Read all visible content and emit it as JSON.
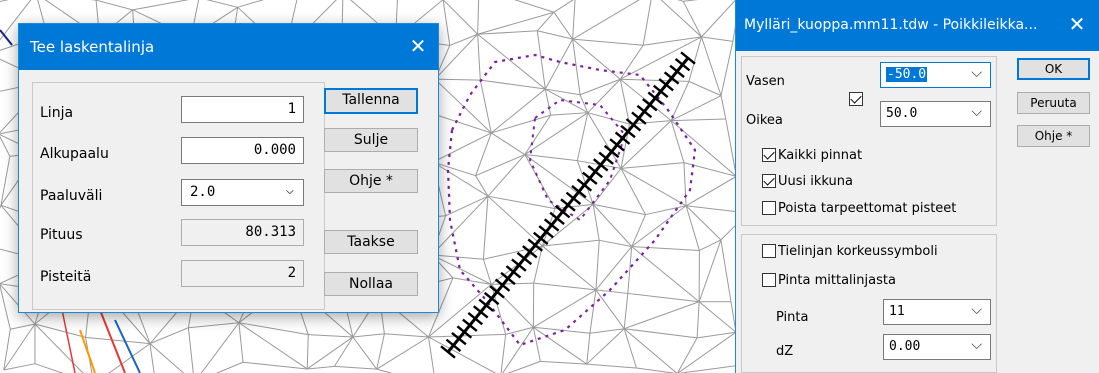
{
  "dialog_laskentalinja": {
    "title": "Tee laskentalinja",
    "close_glyph": "✕",
    "fields": {
      "linja": {
        "label": "Linja",
        "value": "1"
      },
      "alkupaalu": {
        "label": "Alkupaalu",
        "value": "0.000"
      },
      "paaluvali": {
        "label": "Paaluväli",
        "value": "2.0"
      },
      "pituus": {
        "label": "Pituus",
        "value": "80.313"
      },
      "pisteita": {
        "label": "Pisteitä",
        "value": "2"
      }
    },
    "buttons": {
      "tallenna": "Tallenna",
      "sulje": "Sulje",
      "ohje": "Ohje *",
      "taakse": "Taakse",
      "nollaa": "Nollaa"
    }
  },
  "dialog_poikkileikkaus": {
    "title": "Mylläri_kuoppa.mm11.tdw - Poikkileikka...",
    "close_glyph": "✕",
    "vasen": {
      "label": "Vasen",
      "value": "-50.0"
    },
    "oikea": {
      "label": "Oikea",
      "value": "50.0"
    },
    "checkboxes": {
      "kaikki_pinnat": {
        "label": "Kaikki pinnat",
        "checked": true
      },
      "uusi_ikkuna": {
        "label": "Uusi ikkuna",
        "checked": true
      },
      "poista": {
        "label": "Poista tarpeettomat pisteet",
        "checked": false
      },
      "tielinjan": {
        "label": "Tielinjan korkeussymboli",
        "checked": false
      },
      "pinta_mittalinjasta": {
        "label": "Pinta mittalinjasta",
        "checked": false
      }
    },
    "pinta": {
      "label": "Pinta",
      "value": "11"
    },
    "dz": {
      "label": "dZ",
      "value": "0.00"
    },
    "buttons": {
      "ok": "OK",
      "peruuta": "Peruuta",
      "ohje": "Ohje *"
    }
  },
  "icons": {
    "dropdown": "chevron-down-icon",
    "close": "close-icon",
    "checkmark": "checkmark-icon"
  },
  "colors": {
    "titlebar": "#0078d7",
    "dialog_bg": "#f0f0f0",
    "tin_lines": "#9a9a9a",
    "boundary": "#7b1fa2",
    "section_line": "#000000"
  }
}
